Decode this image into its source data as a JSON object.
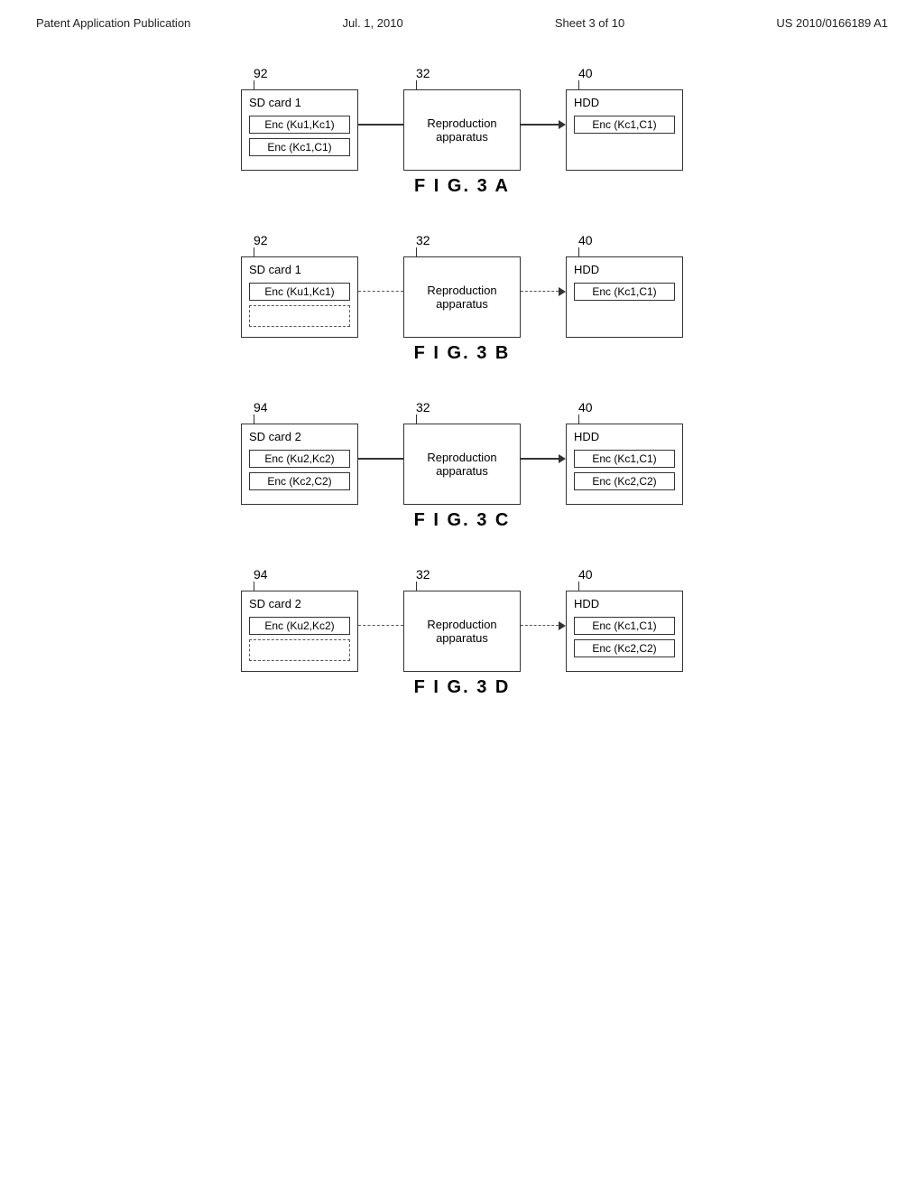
{
  "header": {
    "left": "Patent Application Publication",
    "center": "Jul. 1, 2010",
    "sheet": "Sheet 3 of 10",
    "right": "US 2010/0166189 A1"
  },
  "figures": [
    {
      "id": "fig3a",
      "caption": "F I G. 3 A",
      "nodes": [
        {
          "number": "92",
          "label": "SD card 1",
          "inner_boxes": [
            {
              "text": "Enc (Ku1,Kc1)",
              "dashed": false
            },
            {
              "text": "Enc (Kc1,C1)",
              "dashed": false
            }
          ],
          "connector": "solid"
        },
        {
          "number": "32",
          "label": "Reproduction\napparatus",
          "inner_boxes": [],
          "connector": "solid"
        },
        {
          "number": "40",
          "label": "HDD",
          "inner_boxes": [
            {
              "text": "Enc (Kc1,C1)",
              "dashed": false
            }
          ]
        }
      ]
    },
    {
      "id": "fig3b",
      "caption": "F I G. 3 B",
      "nodes": [
        {
          "number": "92",
          "label": "SD card 1",
          "inner_boxes": [
            {
              "text": "Enc (Ku1,Kc1)",
              "dashed": false
            },
            {
              "text": "",
              "dashed": true
            }
          ],
          "connector": "dashed"
        },
        {
          "number": "32",
          "label": "Reproduction\napparatus",
          "inner_boxes": [],
          "connector": "dashed"
        },
        {
          "number": "40",
          "label": "HDD",
          "inner_boxes": [
            {
              "text": "Enc (Kc1,C1)",
              "dashed": false
            }
          ]
        }
      ]
    },
    {
      "id": "fig3c",
      "caption": "F I G. 3 C",
      "nodes": [
        {
          "number": "94",
          "label": "SD card 2",
          "inner_boxes": [
            {
              "text": "Enc (Ku2,Kc2)",
              "dashed": false
            },
            {
              "text": "Enc (Kc2,C2)",
              "dashed": false
            }
          ],
          "connector": "solid"
        },
        {
          "number": "32",
          "label": "Reproduction\napparatus",
          "inner_boxes": [],
          "connector": "solid"
        },
        {
          "number": "40",
          "label": "HDD",
          "inner_boxes": [
            {
              "text": "Enc (Kc1,C1)",
              "dashed": false
            },
            {
              "text": "Enc (Kc2,C2)",
              "dashed": false
            }
          ]
        }
      ]
    },
    {
      "id": "fig3d",
      "caption": "F I G. 3 D",
      "nodes": [
        {
          "number": "94",
          "label": "SD card 2",
          "inner_boxes": [
            {
              "text": "Enc (Ku2,Kc2)",
              "dashed": false
            },
            {
              "text": "",
              "dashed": true
            }
          ],
          "connector": "dashed"
        },
        {
          "number": "32",
          "label": "Reproduction\napparatus",
          "inner_boxes": [],
          "connector": "dashed"
        },
        {
          "number": "40",
          "label": "HDD",
          "inner_boxes": [
            {
              "text": "Enc (Kc1,C1)",
              "dashed": false
            },
            {
              "text": "Enc (Kc2,C2)",
              "dashed": false
            }
          ]
        }
      ]
    }
  ]
}
